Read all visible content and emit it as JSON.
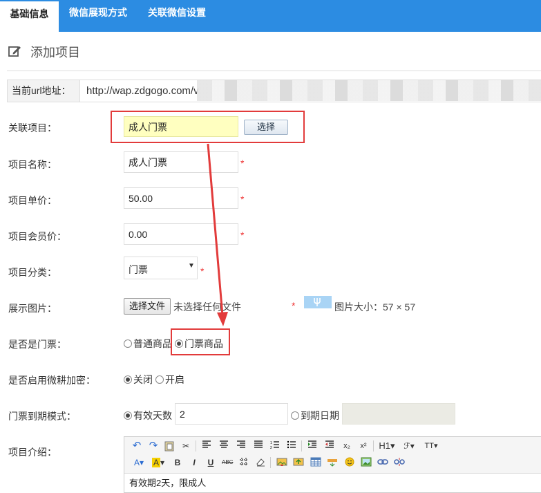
{
  "tabs": [
    {
      "label": "基础信息"
    },
    {
      "label": "微信展现方式"
    },
    {
      "label": "关联微信设置"
    }
  ],
  "page_title": "添加项目",
  "url": {
    "label": "当前url地址：",
    "value": "http://wap.zdgogo.com/v"
  },
  "fields": {
    "related_item": {
      "label": "关联项目：",
      "value": "成人门票",
      "button": "选择"
    },
    "item_name": {
      "label": "项目名称：",
      "value": "成人门票"
    },
    "unit_price": {
      "label": "项目单价：",
      "value": "50.00"
    },
    "member_price": {
      "label": "项目会员价：",
      "value": "0.00"
    },
    "category": {
      "label": "项目分类：",
      "value": "门票"
    },
    "image": {
      "label": "展示图片：",
      "button": "选择文件",
      "status": "未选择任何文件",
      "size": "图片大小：57 × 57"
    },
    "is_ticket": {
      "label": "是否是门票：",
      "options": [
        "普通商品",
        "门票商品"
      ],
      "selected": 1
    },
    "encrypt": {
      "label": "是否启用微耕加密：",
      "options": [
        "关闭",
        "开启"
      ],
      "selected": 0
    },
    "expire_mode": {
      "label": "门票到期模式：",
      "option_days": "有效天数",
      "days_value": "2",
      "option_date": "到期日期"
    },
    "intro": {
      "label": "项目介绍：",
      "content": "有效期2天，限成人"
    }
  },
  "required_mark": "*",
  "colors": {
    "tab_bar": "#2c8ce2",
    "highlight": "#e23b3b",
    "required": "#e33",
    "input_highlight": "#ffffc0"
  },
  "editor_toolbar": {
    "row1": [
      "undo-icon",
      "redo-icon",
      "paste-icon",
      "cut-icon",
      "align-left-icon",
      "align-center-icon",
      "align-right-icon",
      "justify-icon",
      "ordered-list-icon",
      "unordered-list-icon",
      "indent-icon",
      "outdent-icon",
      "subscript-icon",
      "superscript-icon",
      "heading-icon",
      "font-family-icon",
      "font-size-icon"
    ],
    "row2": [
      "font-color-icon",
      "highlight-color-icon",
      "bold-icon",
      "italic-icon",
      "underline-icon",
      "strikethrough-icon",
      "table-grid-icon",
      "eraser-icon",
      "insert-image-icon",
      "image-upload-icon",
      "table-icon",
      "horizontal-line-icon",
      "emoji-icon",
      "picture-icon",
      "link-icon",
      "unlink-icon"
    ],
    "labels": {
      "h1": "H1",
      "tt": "TT",
      "sub": "x₂",
      "sup": "x²",
      "abc": "ABC"
    }
  }
}
